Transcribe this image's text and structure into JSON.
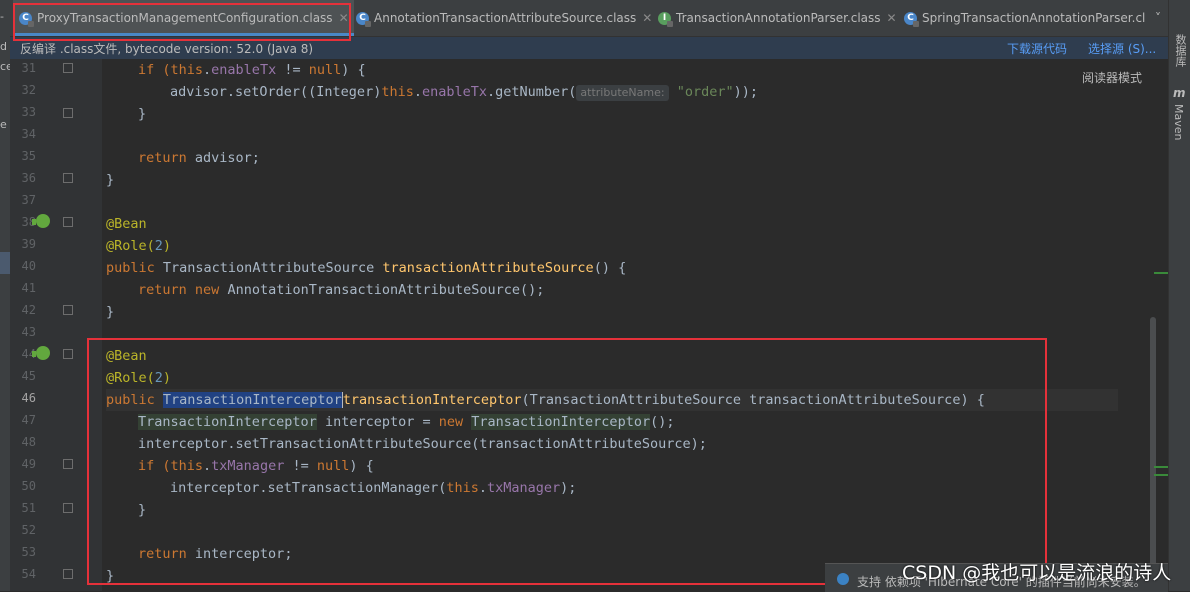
{
  "left_strip": {
    "labels": [
      "-",
      "d",
      "ce",
      "e"
    ]
  },
  "tabs": [
    {
      "label": "ProxyTransactionManagementConfiguration.class",
      "active": true,
      "icon": "class-icon"
    },
    {
      "label": "AnnotationTransactionAttributeSource.class",
      "active": false,
      "icon": "class-icon"
    },
    {
      "label": "TransactionAnnotationParser.class",
      "active": false,
      "icon": "interface-icon"
    },
    {
      "label": "SpringTransactionAnnotationParser.cl",
      "active": false,
      "icon": "class-icon"
    }
  ],
  "tab_overflow": "˅",
  "infobar": {
    "message": "反编译 .class文件, bytecode version: 52.0 (Java 8)",
    "download_link": "下载源代码",
    "choose_link": "选择源 (S)..."
  },
  "reader_mode": "阅读器模式",
  "right_strip": {
    "top": "数据库",
    "maven_icon": "m",
    "maven": "Maven"
  },
  "line_numbers": [
    "31",
    "32",
    "33",
    "34",
    "35",
    "36",
    "37",
    "38",
    "39",
    "40",
    "41",
    "42",
    "43",
    "44",
    "45",
    "46",
    "47",
    "48",
    "49",
    "50",
    "51",
    "52",
    "53",
    "54"
  ],
  "current_line": "46",
  "code": {
    "l31": [
      "if (",
      "this",
      ".",
      "enableTx",
      " != ",
      "null",
      ") {"
    ],
    "l32": [
      "advisor.setOrder((Integer)",
      "this",
      ".",
      "enableTx",
      ".getNumber(",
      "attributeName:",
      " ",
      "\"order\"",
      "));"
    ],
    "l33": "}",
    "l35": [
      "return",
      " advisor;"
    ],
    "l36": "}",
    "l38": "@Bean",
    "l39": [
      "@Role(",
      "2",
      ")"
    ],
    "l40": [
      "public",
      " TransactionAttributeSource ",
      "transactionAttributeSource",
      "() {"
    ],
    "l41": [
      "return",
      " ",
      "new",
      " AnnotationTransactionAttributeSource();"
    ],
    "l42": "}",
    "l44": "@Bean",
    "l45": [
      "@Role(",
      "2",
      ")"
    ],
    "l46": [
      "public",
      " ",
      "TransactionInterceptor",
      " ",
      "transactionInterceptor",
      "(TransactionAttributeSource transactionAttributeSource) {"
    ],
    "l47": [
      "TransactionInterceptor",
      " interceptor = ",
      "new",
      " ",
      "TransactionInterceptor",
      "();"
    ],
    "l48": "interceptor.setTransactionAttributeSource(transactionAttributeSource);",
    "l49": [
      "if (",
      "this",
      ".",
      "txManager",
      " != ",
      "null",
      ") {"
    ],
    "l50": [
      "interceptor.setTransactionManager(",
      "this",
      ".",
      "txManager",
      ");"
    ],
    "l51": "}",
    "l53": [
      "return",
      " interceptor;"
    ],
    "l54": "}"
  },
  "notification": {
    "text": "支持 依赖项 'Hibernate Core' 的插件当前尚未安装。"
  },
  "watermark": "CSDN @我也可以是流浪的诗人",
  "colors": {
    "keyword": "#cc7832",
    "annotation": "#bbb529",
    "method": "#ffc66d",
    "field": "#9876aa",
    "string": "#6a8759",
    "number": "#6897bb",
    "highlight_box": "#e5313a"
  }
}
